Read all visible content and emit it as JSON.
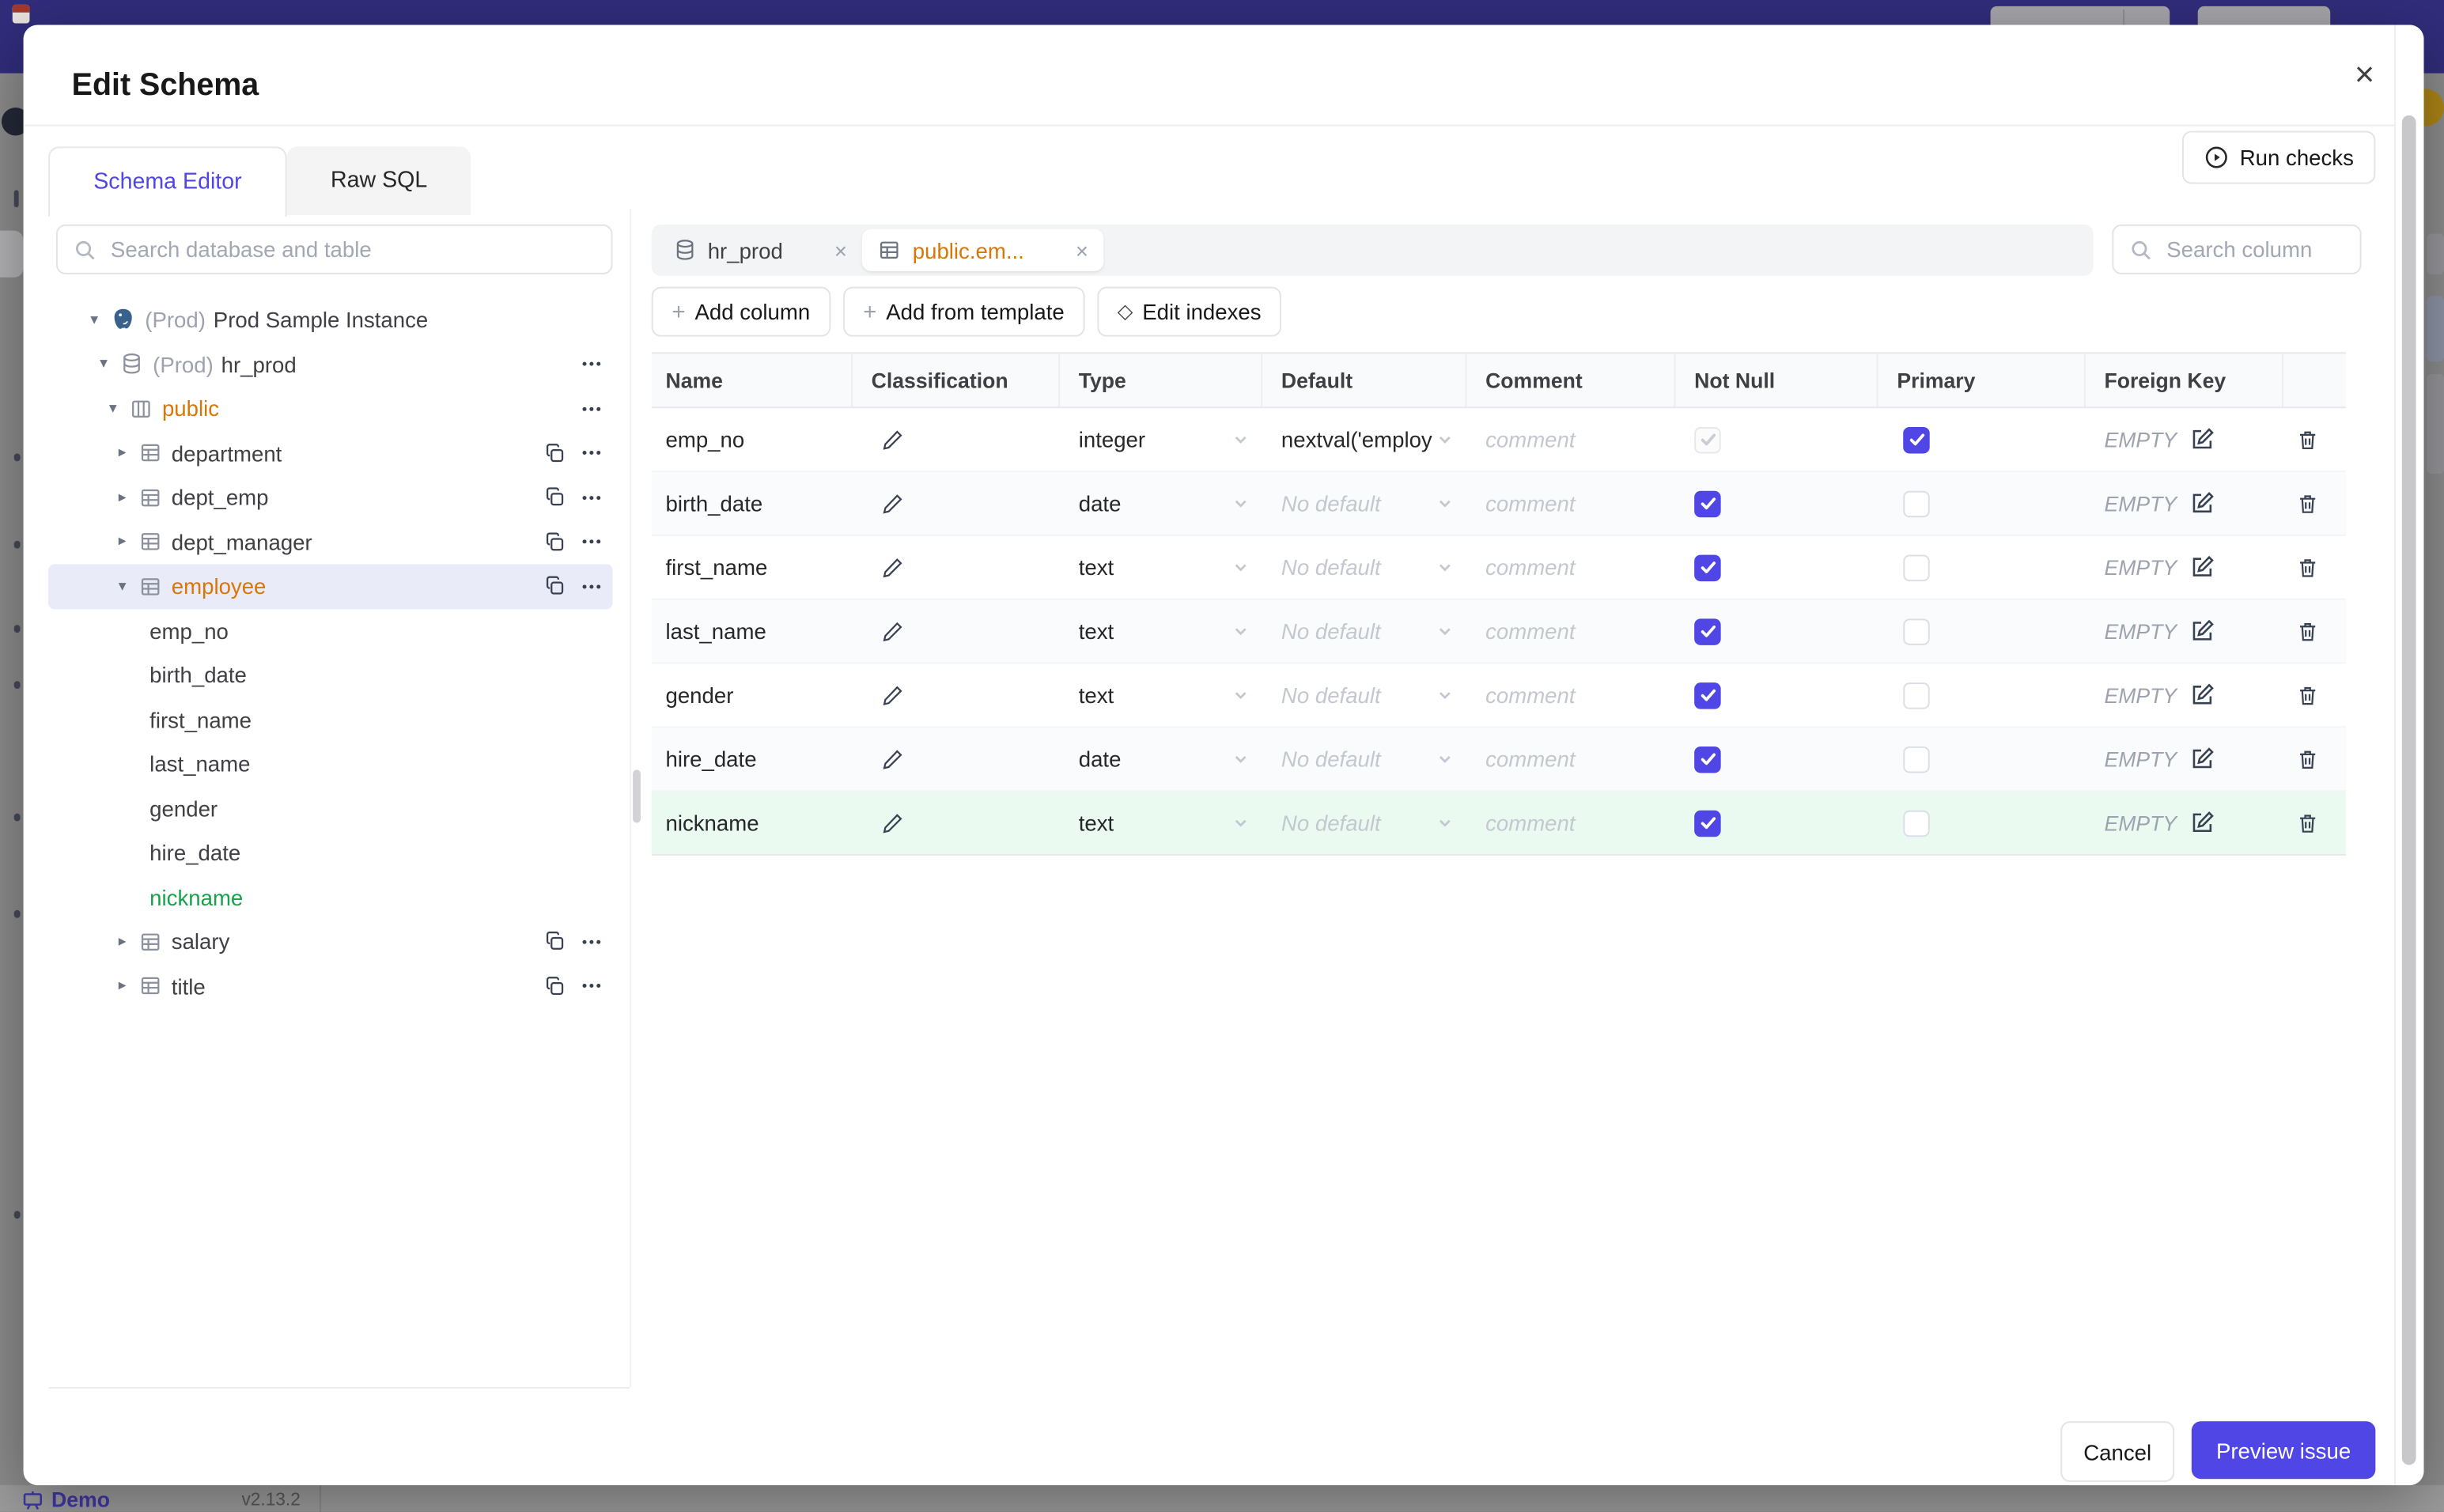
{
  "backdrop": {
    "demo_label": "Demo",
    "version": "v2.13.2"
  },
  "dialog": {
    "title": "Edit Schema",
    "close_icon": "×",
    "tabs": {
      "schema_editor": "Schema Editor",
      "raw_sql": "Raw SQL"
    },
    "run_checks_label": "Run checks"
  },
  "sidebar": {
    "search_placeholder": "Search database and table",
    "tree": [
      {
        "label": "Prod Sample Instance",
        "prefix": "(Prod)",
        "icon": "postgres",
        "level": 1,
        "state": "expanded",
        "actions": []
      },
      {
        "label": "hr_prod",
        "prefix": "(Prod)",
        "icon": "database",
        "level": 2,
        "state": "expanded",
        "actions": [
          "more"
        ]
      },
      {
        "label": "public",
        "icon": "schema",
        "level": 3,
        "state": "expanded",
        "modified": true,
        "actions": [
          "more"
        ]
      },
      {
        "label": "department",
        "icon": "table",
        "level": 4,
        "state": "collapsed",
        "actions": [
          "copy",
          "more"
        ]
      },
      {
        "label": "dept_emp",
        "icon": "table",
        "level": 4,
        "state": "collapsed",
        "actions": [
          "copy",
          "more"
        ]
      },
      {
        "label": "dept_manager",
        "icon": "table",
        "level": 4,
        "state": "collapsed",
        "actions": [
          "copy",
          "more"
        ]
      },
      {
        "label": "employee",
        "icon": "table",
        "level": 4,
        "state": "expanded",
        "modified": true,
        "selected": true,
        "actions": [
          "copy",
          "more"
        ]
      },
      {
        "label": "emp_no",
        "level": 5
      },
      {
        "label": "birth_date",
        "level": 5
      },
      {
        "label": "first_name",
        "level": 5
      },
      {
        "label": "last_name",
        "level": 5
      },
      {
        "label": "gender",
        "level": 5
      },
      {
        "label": "hire_date",
        "level": 5
      },
      {
        "label": "nickname",
        "level": 5,
        "created": true
      },
      {
        "label": "salary",
        "icon": "table",
        "level": 4,
        "state": "collapsed",
        "actions": [
          "copy",
          "more"
        ]
      },
      {
        "label": "title",
        "icon": "table",
        "level": 4,
        "state": "collapsed",
        "actions": [
          "copy",
          "more"
        ]
      }
    ]
  },
  "main": {
    "tabs": [
      {
        "label": "hr_prod",
        "icon": "database",
        "active": false
      },
      {
        "label": "public.em...",
        "icon": "table",
        "active": true
      }
    ],
    "search_placeholder": "Search column",
    "actions": [
      {
        "icon": "plus",
        "label": "Add column"
      },
      {
        "icon": "plus",
        "label": "Add from template"
      },
      {
        "icon": "diamond",
        "label": "Edit indexes"
      }
    ],
    "table": {
      "headers": [
        "Name",
        "Classification",
        "Type",
        "Default",
        "Comment",
        "Not Null",
        "Primary",
        "Foreign Key",
        ""
      ],
      "comment_placeholder": "comment",
      "empty_label": "EMPTY",
      "rows": [
        {
          "name": "emp_no",
          "type": "integer",
          "default": "nextval('employ",
          "has_default": true,
          "not_null": true,
          "not_null_disabled": true,
          "primary": true,
          "created": false
        },
        {
          "name": "birth_date",
          "type": "date",
          "default": "No default",
          "has_default": false,
          "not_null": true,
          "not_null_disabled": false,
          "primary": false,
          "created": false
        },
        {
          "name": "first_name",
          "type": "text",
          "default": "No default",
          "has_default": false,
          "not_null": true,
          "not_null_disabled": false,
          "primary": false,
          "created": false
        },
        {
          "name": "last_name",
          "type": "text",
          "default": "No default",
          "has_default": false,
          "not_null": true,
          "not_null_disabled": false,
          "primary": false,
          "created": false
        },
        {
          "name": "gender",
          "type": "text",
          "default": "No default",
          "has_default": false,
          "not_null": true,
          "not_null_disabled": false,
          "primary": false,
          "created": false
        },
        {
          "name": "hire_date",
          "type": "date",
          "default": "No default",
          "has_default": false,
          "not_null": true,
          "not_null_disabled": false,
          "primary": false,
          "created": false
        },
        {
          "name": "nickname",
          "type": "text",
          "default": "No default",
          "has_default": false,
          "not_null": true,
          "not_null_disabled": false,
          "primary": false,
          "created": true
        }
      ]
    }
  },
  "footer": {
    "cancel": "Cancel",
    "primary": "Preview issue"
  },
  "colors": {
    "accent": "#4f46e5",
    "modified": "#d97706",
    "created": "#16a34a",
    "selected_bg": "#e9ebf9",
    "created_row_bg": "#eafaf1"
  }
}
